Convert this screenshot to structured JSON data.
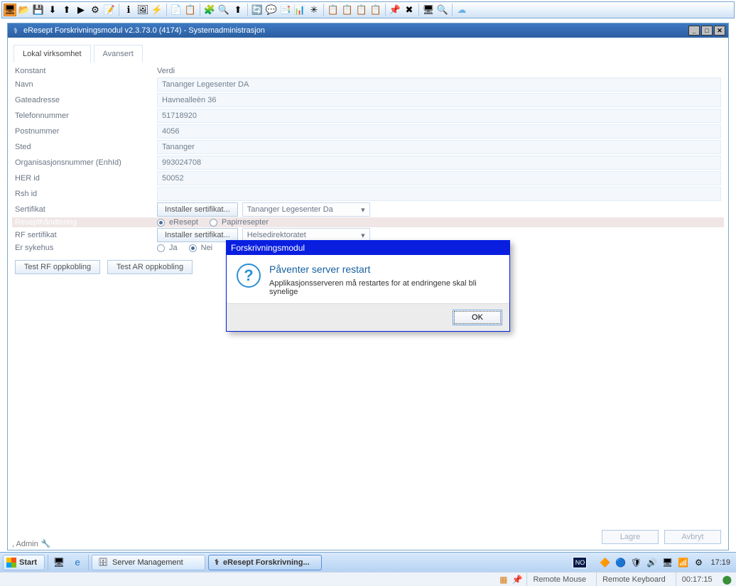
{
  "window": {
    "title": "eResept Forskrivningsmodul v2.3.73.0 (4174) - Systemadministrasjon"
  },
  "tabs": {
    "local": "Lokal virksomhet",
    "advanced": "Avansert"
  },
  "formHeader": {
    "col1": "Konstant",
    "col2": "Verdi"
  },
  "fields": {
    "navn": {
      "label": "Navn",
      "value": "Tananger Legesenter DA"
    },
    "gate": {
      "label": "Gateadresse",
      "value": "Havnealleèn 36"
    },
    "tlf": {
      "label": "Telefonnummer",
      "value": "51718920"
    },
    "post": {
      "label": "Postnummer",
      "value": "4056"
    },
    "sted": {
      "label": "Sted",
      "value": "Tananger"
    },
    "org": {
      "label": "Organisasjonsnummer (EnhId)",
      "value": "993024708"
    },
    "her": {
      "label": "HER id",
      "value": "50052"
    },
    "rsh": {
      "label": "Rsh id",
      "value": ""
    },
    "sert": {
      "label": "Sertifikat",
      "btn": "Installer sertifikat...",
      "select": "Tananger Legesenter Da"
    },
    "resept": {
      "label": "Resepthåndtering",
      "opt1": "eResept",
      "opt2": "Papirresepter"
    },
    "rfsert": {
      "label": "RF sertifikat",
      "btn": "Installer sertifikat...",
      "select": "Helsedirektoratet"
    },
    "sykehus": {
      "label": "Er sykehus",
      "opt1": "Ja",
      "opt2": "Nei"
    }
  },
  "buttons": {
    "testRF": "Test RF oppkobling",
    "testAR": "Test AR oppkobling",
    "save": "Lagre",
    "cancel": "Avbryt"
  },
  "admin": ", Admin",
  "dialog": {
    "title": "Forskrivningsmodul",
    "heading": "Påventer server restart",
    "body": "Applikasjonsserveren må restartes for at endringene skal bli synelige",
    "ok": "OK"
  },
  "taskbar": {
    "start": "Start",
    "task1": "Server Management",
    "task2": "eResept Forskrivning...",
    "lang": "NO",
    "clock": "17:19"
  },
  "status": {
    "remoteMouse": "Remote Mouse",
    "remoteKeyboard": "Remote Keyboard",
    "time": "00:17:15"
  }
}
